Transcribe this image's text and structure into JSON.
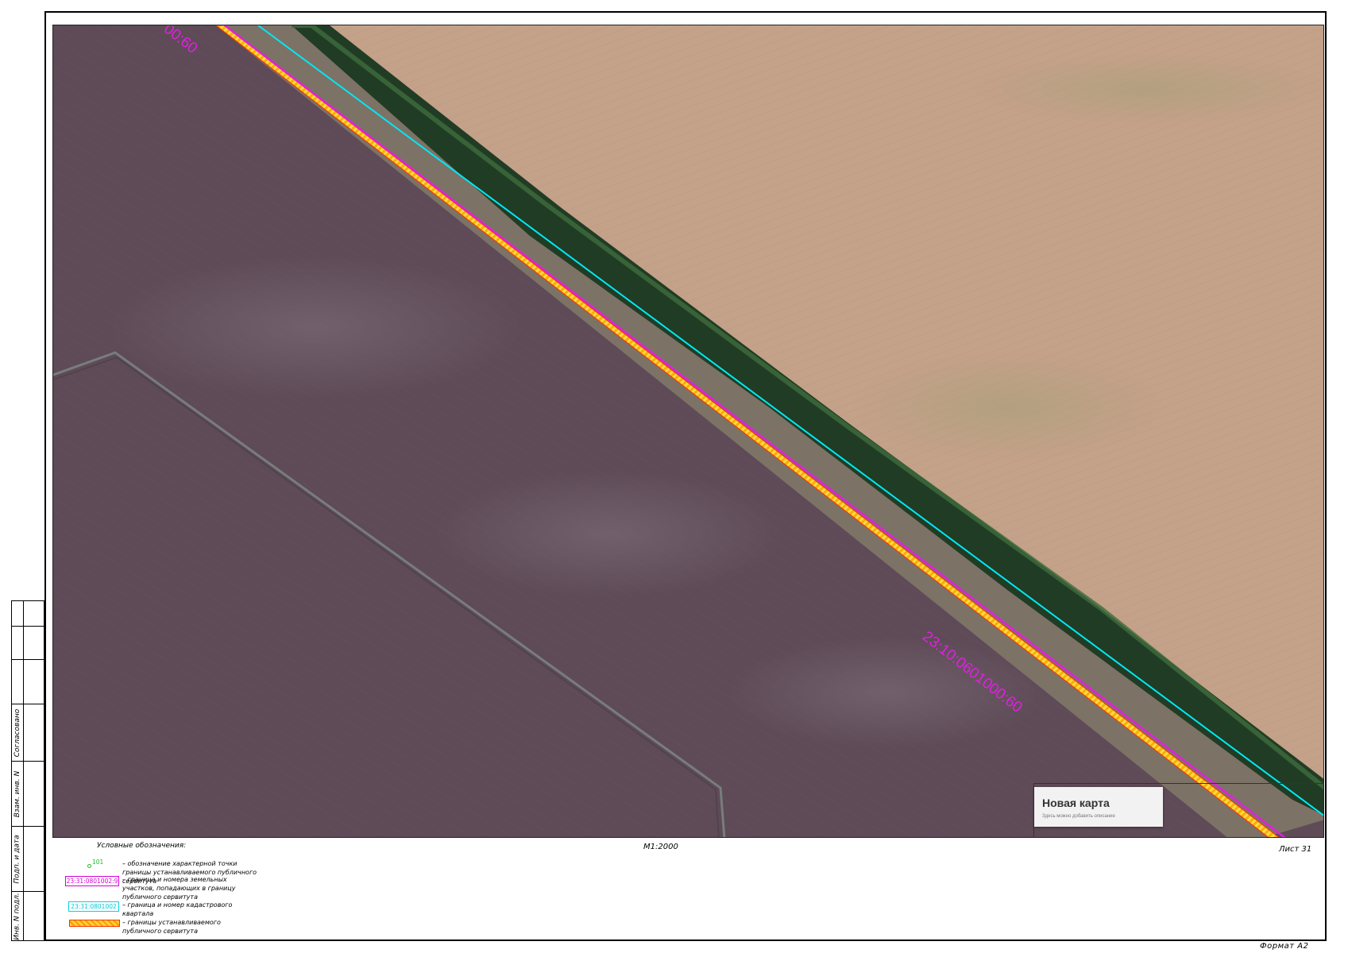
{
  "map": {
    "parcel_label_main": "23:10:0601000:60",
    "parcel_label_corner": "00:60",
    "colors": {
      "parcel_boundary": "#e020e0",
      "quarter_boundary": "#00e0f0",
      "servitude_fill": "#f5b000",
      "servitude_border": "#ff3000",
      "field_dark": "#5e4a56",
      "field_light": "#c2a186",
      "tree_belt": "#1e3a22"
    }
  },
  "inset": {
    "title": "Новая карта",
    "subtitle": "Здесь можно добавить описание"
  },
  "sheet": {
    "scale": "М1:2000",
    "sheet_number": "Лист 31",
    "format": "Формат А2"
  },
  "side_stamp": {
    "agreed": "Согласовано",
    "vzam_inv": "Взам. инв. N",
    "podp_data": "Подп. и дата",
    "inv_podl": "Инв. N подл."
  },
  "legend": {
    "title": "Условные обозначения:",
    "items": [
      {
        "symbol": "point",
        "symbol_text": "101",
        "description": "– обозначение характерной точки границы устанавливаемого публичного сервитута"
      },
      {
        "symbol": "parcel-box",
        "symbol_text": "23:31:0801002:9",
        "description": "– граница и номера земельных участков, попадающих в границу публичного сервитута"
      },
      {
        "symbol": "quarter-box",
        "symbol_text": "23:31:0801002",
        "description": "– граница и номер кадастрового квартала"
      },
      {
        "symbol": "servitude-band",
        "symbol_text": "",
        "description": "– границы устанавливаемого публичного сервитута"
      }
    ]
  }
}
